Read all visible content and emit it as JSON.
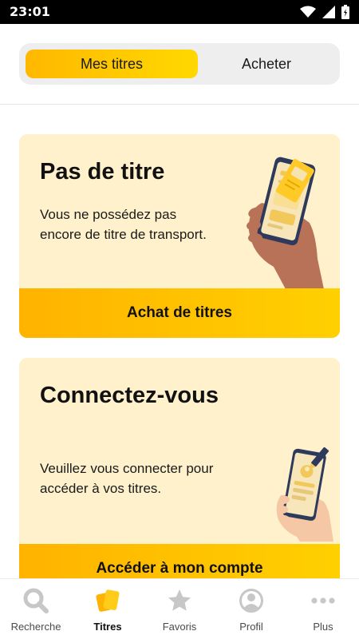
{
  "status": {
    "time": "23:01"
  },
  "tabs": {
    "active_label": "Mes titres",
    "inactive_label": "Acheter"
  },
  "card_no_ticket": {
    "title": "Pas de titre",
    "text": "Vous ne possédez pas encore de titre de transport.",
    "button_label": "Achat de titres"
  },
  "card_login": {
    "title": "Connectez-vous",
    "text": "Veuillez vous connecter pour accéder à vos titres.",
    "button_label": "Accéder à mon compte"
  },
  "nav": {
    "items": [
      {
        "label": "Recherche",
        "icon": "search-icon",
        "active": false
      },
      {
        "label": "Titres",
        "icon": "tickets-icon",
        "active": true
      },
      {
        "label": "Favoris",
        "icon": "star-icon",
        "active": false
      },
      {
        "label": "Profil",
        "icon": "profile-icon",
        "active": false
      },
      {
        "label": "Plus",
        "icon": "more-icon",
        "active": false
      }
    ]
  },
  "colors": {
    "accent_start": "#FFB300",
    "accent_end": "#FFD000",
    "card_bg": "#FEF1CC",
    "inactive_icon": "#c7c7c7"
  }
}
